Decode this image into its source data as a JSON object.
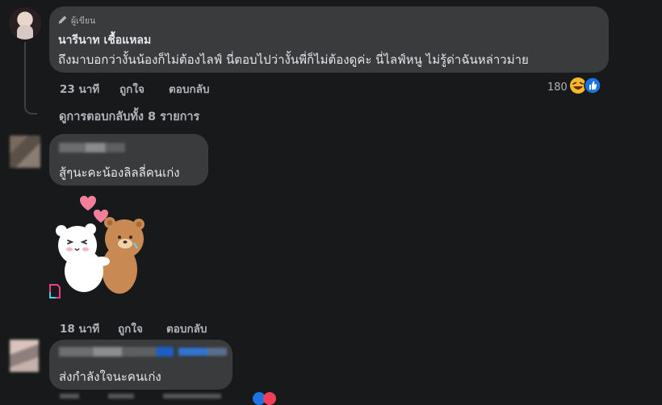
{
  "comments": [
    {
      "author_badge": "ผู้เขียน",
      "author_name": "นารีนาท เชื้อแหลม",
      "text": "ถึงมาบอกว่างั้นน้องก็ไม่ต้องไลฟ์ นี่ตอบไปว่างั้นพี่ก็ไม่ต้องดูค่ะ นี่ไลฟ์หนู ไม่รู้ด่าฉันหล่าวม่าย",
      "time": "23 นาที",
      "like_label": "ถูกใจ",
      "reply_label": "ตอบกลับ",
      "reaction_count": "180"
    },
    {
      "text": "สู้ๆนะคะน้องลิลลี่คนเก่ง",
      "time": "18 นาที",
      "like_label": "ถูกใจ",
      "reply_label": "ตอบกลับ"
    },
    {
      "text": "ส่งกำลังใจนะคนเก่ง"
    }
  ],
  "view_replies_label": "ดูการตอบกลับทั้ง 8 รายการ",
  "colors": {
    "background": "#18191a",
    "bubble": "#3a3b3c",
    "meta_text": "#b0b3b8",
    "like_blue": "#1b74e4",
    "laugh_yellow": "#f7b928"
  },
  "icons": [
    "pencil-icon",
    "laugh-reaction-icon",
    "like-reaction-icon",
    "heart-reaction-icon",
    "sticker-icon"
  ]
}
